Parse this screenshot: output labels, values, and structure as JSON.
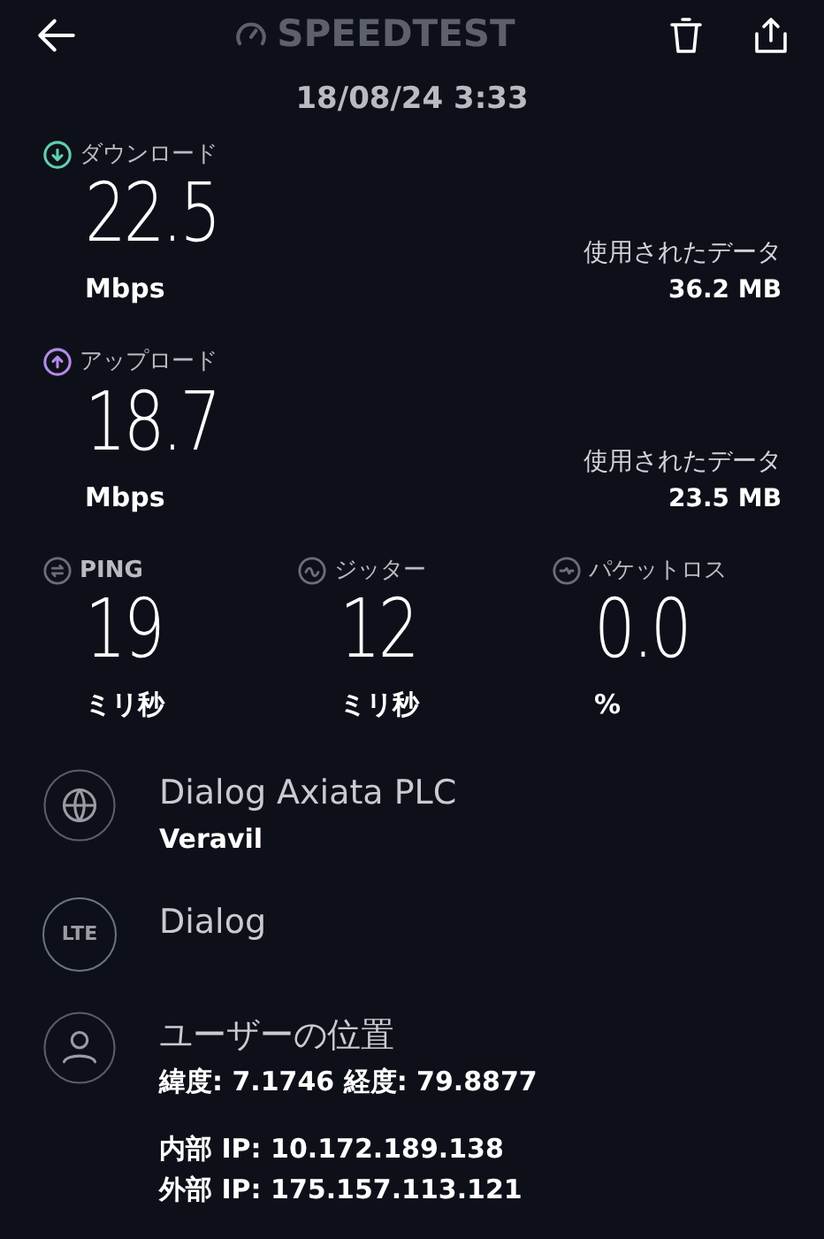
{
  "header": {
    "logo": "SPEEDTEST",
    "date": "18/08/24 3:33"
  },
  "speeds": [
    {
      "kind": "download",
      "label": "ダウンロード",
      "color": "#5fd0b0",
      "value": "22.5",
      "unit": "Mbps",
      "data_label": "使用されたデータ",
      "data_value": "36.2 MB"
    },
    {
      "kind": "upload",
      "label": "アップロード",
      "color": "#b48ae8",
      "value": "18.7",
      "unit": "Mbps",
      "data_label": "使用されたデータ",
      "data_value": "23.5 MB"
    }
  ],
  "metrics": [
    {
      "kind": "ping",
      "label": "PING",
      "value": "19",
      "unit": "ミリ秒"
    },
    {
      "kind": "jitter",
      "label": "ジッター",
      "value": "12",
      "unit": "ミリ秒"
    },
    {
      "kind": "loss",
      "label": "パケットロス",
      "value": "0.0",
      "unit": "%"
    }
  ],
  "info": [
    {
      "kind": "provider",
      "title": "Dialog Axiata PLC",
      "lines": [
        "Veravil"
      ]
    },
    {
      "kind": "network",
      "badge": "LTE",
      "title": "Dialog"
    },
    {
      "kind": "location",
      "title": "ユーザーの位置",
      "lines": [
        "緯度: 7.1746 経度: 79.8877"
      ],
      "extra_lines": [
        "内部 IP: 10.172.189.138",
        "外部 IP: 175.157.113.121"
      ]
    }
  ]
}
